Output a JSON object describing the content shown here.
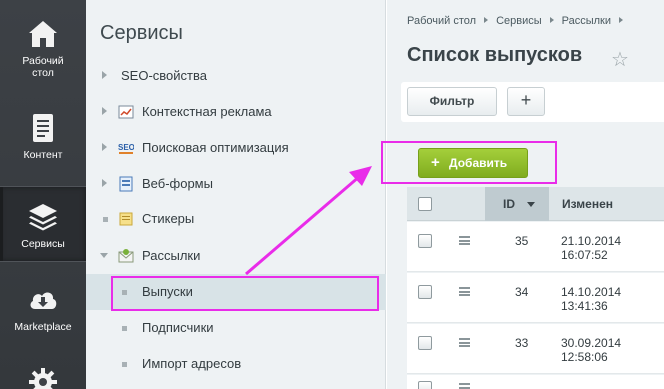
{
  "leftnav": {
    "items": [
      {
        "label_line1": "Рабочий",
        "label_line2": "стол",
        "icon": "home-icon"
      },
      {
        "label_line1": "Контент",
        "label_line2": "",
        "icon": "document-icon"
      },
      {
        "label_line1": "Сервисы",
        "label_line2": "",
        "icon": "layers-icon"
      },
      {
        "label_line1": "Marketplace",
        "label_line2": "",
        "icon": "cloud-download-icon"
      },
      {
        "icon": "gear-icon"
      }
    ]
  },
  "sidebar": {
    "title": "Сервисы",
    "items": [
      {
        "label": "SEO-свойства"
      },
      {
        "label": "Контекстная реклама"
      },
      {
        "label": "Поисковая оптимизация"
      },
      {
        "label": "Веб-формы"
      },
      {
        "label": "Стикеры"
      },
      {
        "label": "Рассылки"
      },
      {
        "label": "Выпуски"
      },
      {
        "label": "Подписчики"
      },
      {
        "label": "Импорт адресов"
      }
    ]
  },
  "main": {
    "breadcrumb": [
      "Рабочий стол",
      "Сервисы",
      "Рассылки"
    ],
    "title": "Список выпусков",
    "filter_label": "Фильтр",
    "plus_label": "+",
    "add_label": "Добавить",
    "grid": {
      "col_id": "ID",
      "col_changed": "Изменен",
      "rows": [
        {
          "id": "35",
          "date": "21.10.2014",
          "time": "16:07:52"
        },
        {
          "id": "34",
          "date": "14.10.2014",
          "time": "13:41:36"
        },
        {
          "id": "33",
          "date": "30.09.2014",
          "time": "12:58:06"
        }
      ]
    }
  },
  "colors": {
    "highlight": "#e92ce9",
    "add_button": "#8cbb25",
    "nav_bg": "#3a3e43"
  }
}
